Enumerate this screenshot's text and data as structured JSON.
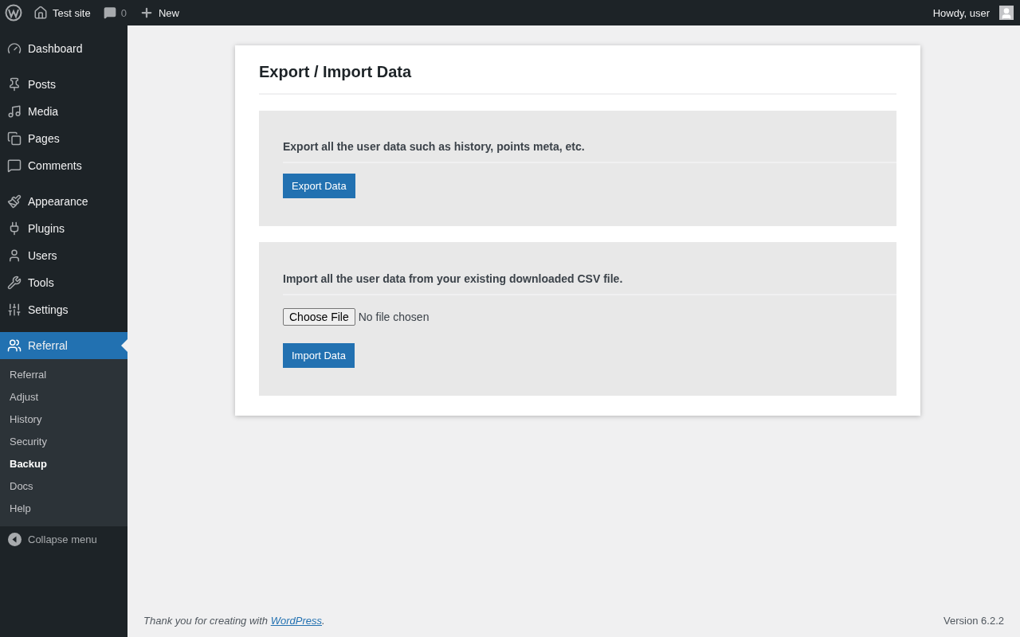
{
  "admin_bar": {
    "site_name": "Test site",
    "comment_count": "0",
    "new_label": "New",
    "greeting": "Howdy, user"
  },
  "sidebar": {
    "groups": [
      [
        {
          "label": "Dashboard",
          "selected": false
        }
      ],
      [
        {
          "label": "Posts",
          "selected": false
        },
        {
          "label": "Media",
          "selected": false
        },
        {
          "label": "Pages",
          "selected": false
        },
        {
          "label": "Comments",
          "selected": false
        }
      ],
      [
        {
          "label": "Appearance",
          "selected": false
        },
        {
          "label": "Plugins",
          "selected": false
        },
        {
          "label": "Users",
          "selected": false
        },
        {
          "label": "Tools",
          "selected": false
        },
        {
          "label": "Settings",
          "selected": false
        }
      ],
      [
        {
          "label": "Referral",
          "selected": true
        }
      ]
    ],
    "submenu": [
      {
        "label": "Referral",
        "selected": false
      },
      {
        "label": "Adjust",
        "selected": false
      },
      {
        "label": "History",
        "selected": false
      },
      {
        "label": "Security",
        "selected": false
      },
      {
        "label": "Backup",
        "selected": true
      },
      {
        "label": "Docs",
        "selected": false
      },
      {
        "label": "Help",
        "selected": false
      }
    ],
    "collapse_label": "Collapse menu"
  },
  "page": {
    "title": "Export / Import Data",
    "sections": [
      {
        "kind": "export",
        "description": "Export all the user data such as history, points meta, etc.",
        "button": "Export Data"
      },
      {
        "kind": "import",
        "description": "Import all the user data from your existing downloaded CSV file.",
        "file_button": "Choose File",
        "file_status": "No file chosen",
        "button": "Import Data"
      }
    ]
  },
  "footer": {
    "thanks": "Thank you for creating with ",
    "link": "WordPress",
    "after": ".",
    "version": "Version 6.2.2"
  }
}
